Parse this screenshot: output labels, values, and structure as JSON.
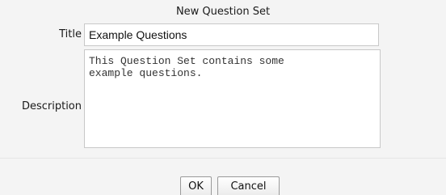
{
  "dialog": {
    "title": "New Question Set"
  },
  "form": {
    "title_label": "Title",
    "title_value": "Example Questions",
    "description_label": "Description",
    "description_value": "This Question Set contains some\nexample questions."
  },
  "buttons": {
    "ok_label": "OK",
    "cancel_label": "Cancel"
  }
}
